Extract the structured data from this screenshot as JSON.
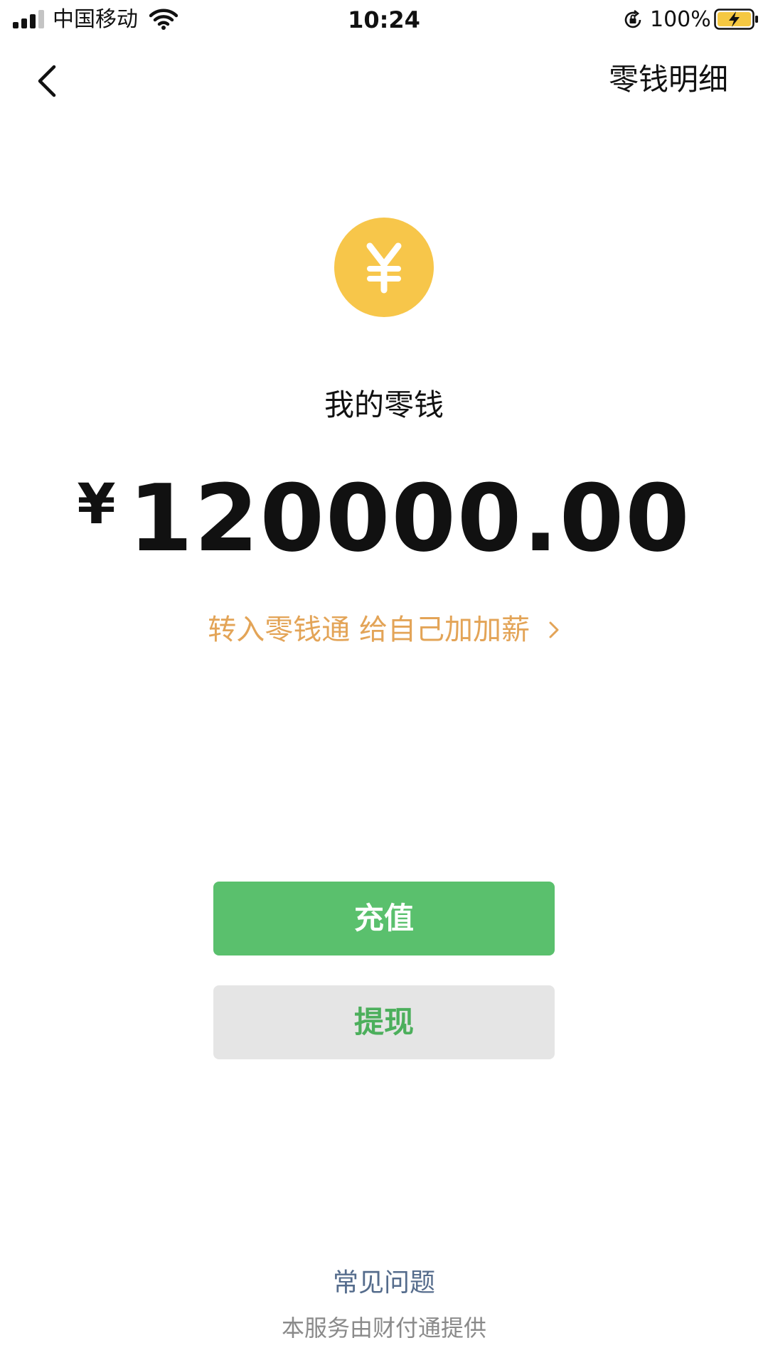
{
  "status_bar": {
    "carrier": "中国移动",
    "time": "10:24",
    "battery_percent": "100%"
  },
  "nav": {
    "right_link": "零钱明细"
  },
  "wallet": {
    "label": "我的零钱",
    "currency_symbol": "¥",
    "amount": "120000.00"
  },
  "promo": {
    "text": "转入零钱通 给自己加加薪"
  },
  "actions": {
    "recharge_label": "充值",
    "withdraw_label": "提现"
  },
  "footer": {
    "faq": "常见问题",
    "provider": "本服务由财付通提供"
  },
  "colors": {
    "coin": "#f7c64a",
    "promo": "#e3a457",
    "primary_green": "#5ac06d",
    "secondary_bg": "#e5e5e5",
    "link_blue": "#556c8c"
  }
}
